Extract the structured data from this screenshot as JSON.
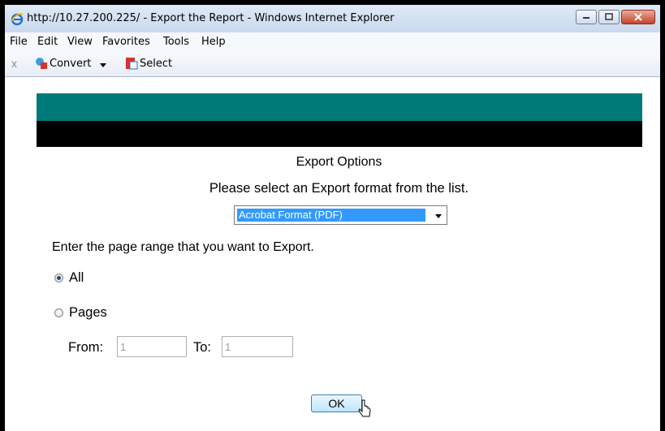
{
  "window": {
    "title": "http://10.27.200.225/ - Export the Report - Windows Internet Explorer",
    "icon": "ie-icon"
  },
  "menu": [
    "File",
    "Edit",
    "View",
    "Favorites",
    "Tools",
    "Help"
  ],
  "toolbar": {
    "close_glyph": "x",
    "convert_label": "Convert",
    "select_label": "Select"
  },
  "content": {
    "banner_colors": {
      "top": "#007a78",
      "bottom": "#000000"
    },
    "title": "Export Options",
    "subtitle": "Please select an Export format from the list.",
    "format_select": {
      "selected": "Acrobat Format (PDF)"
    },
    "range_prompt": "Enter the page range that you want to Export.",
    "radio_all": {
      "label": "All",
      "checked": true
    },
    "radio_pages": {
      "label": "Pages",
      "checked": false
    },
    "from": {
      "label": "From:",
      "value": "1"
    },
    "to": {
      "label": "To:",
      "value": "1"
    },
    "ok_label": "OK"
  }
}
